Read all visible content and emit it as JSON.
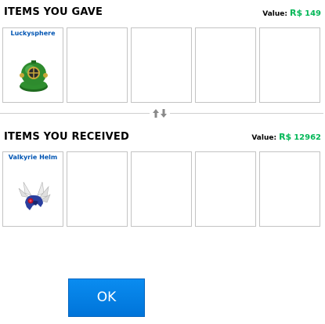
{
  "gave": {
    "title": "ITEMS YOU GAVE",
    "value_label": "Value:",
    "currency_symbol": "R$",
    "value_amount": "149",
    "items": [
      {
        "name": "Luckysphere",
        "icon": "green-diving-helmet-icon"
      },
      {
        "name": ""
      },
      {
        "name": ""
      },
      {
        "name": ""
      },
      {
        "name": ""
      }
    ]
  },
  "swap_icon": "swap-arrows-icon",
  "received": {
    "title": "ITEMS YOU RECEIVED",
    "value_label": "Value:",
    "currency_symbol": "R$",
    "value_amount": "12962",
    "items": [
      {
        "name": "Valkyrie Helm",
        "icon": "valkyrie-helm-icon"
      },
      {
        "name": ""
      },
      {
        "name": ""
      },
      {
        "name": ""
      },
      {
        "name": ""
      }
    ]
  },
  "ok_button": {
    "label": "OK"
  },
  "colors": {
    "robux_green": "#02b757",
    "item_name_blue": "#0055b3",
    "ok_blue": "#0079e0"
  }
}
